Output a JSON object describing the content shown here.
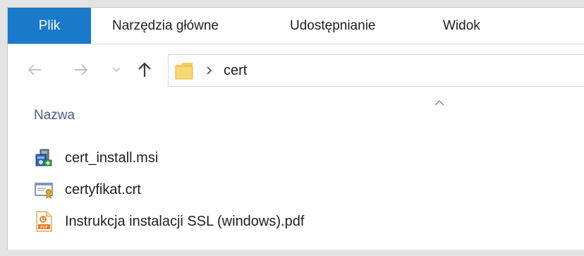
{
  "ribbon": {
    "tabs": [
      {
        "label": "Plik",
        "active": true
      },
      {
        "label": "Narzędzia główne"
      },
      {
        "label": "Udostępnianie"
      },
      {
        "label": "Widok"
      }
    ],
    "active_color": "#1979ca"
  },
  "nav": {
    "back_icon": "arrow-left-icon",
    "forward_icon": "arrow-right-icon",
    "recent_icon": "chevron-down-icon",
    "up_icon": "arrow-up-icon"
  },
  "address": {
    "folder_icon": "folder-icon",
    "separator_icon": "chevron-right-icon",
    "path": "cert"
  },
  "list": {
    "columns": [
      {
        "label": "Nazwa",
        "sort": "ascending"
      }
    ],
    "files": [
      {
        "name": "cert_install.msi",
        "icon": "msi-installer-icon"
      },
      {
        "name": "certyfikat.crt",
        "icon": "certificate-icon"
      },
      {
        "name": "Instrukcja instalacji SSL (windows).pdf",
        "icon": "pdf-file-icon"
      }
    ]
  }
}
